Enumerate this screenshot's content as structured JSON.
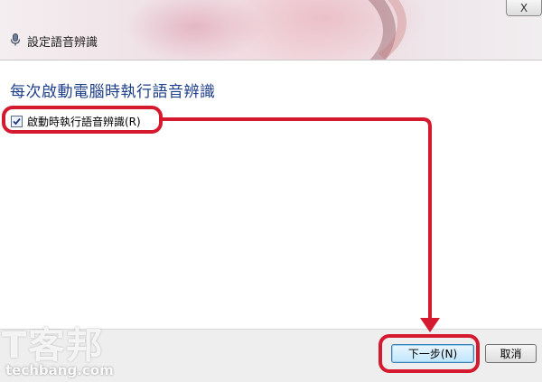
{
  "window": {
    "title": "設定語音辨識",
    "close_label": "X"
  },
  "page": {
    "heading": "每次啟動電腦時執行語音辨識"
  },
  "option": {
    "label": "啟動時執行語音辨識(R)",
    "checked": true
  },
  "buttons": {
    "next_label": "下一步(N)",
    "cancel_label": "取消"
  },
  "watermark": {
    "logo_text": "T客邦",
    "url_text": "techbang.com"
  },
  "colors": {
    "heading": "#1e3f8a",
    "callout": "#d51a2f"
  },
  "icons": {
    "title_icon": "microphone-icon",
    "check": "checkmark-icon"
  }
}
